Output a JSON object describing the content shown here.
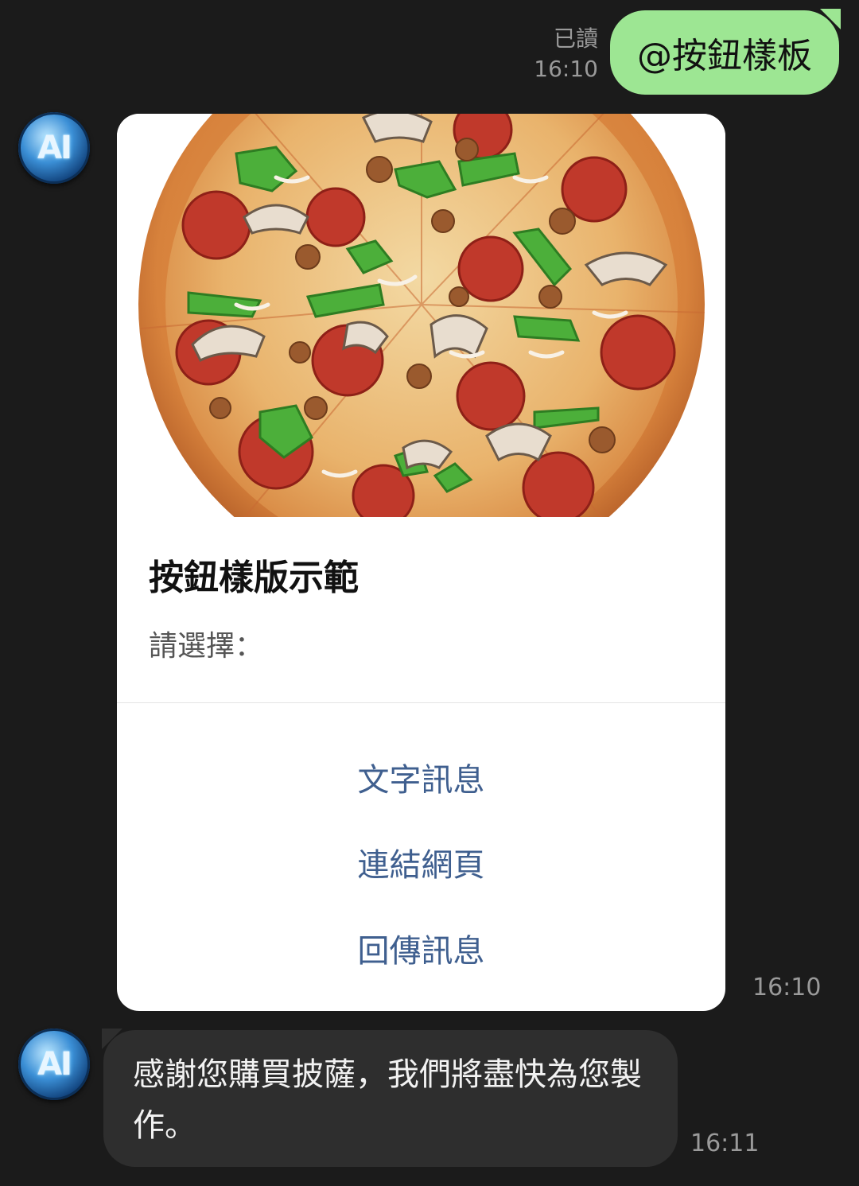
{
  "outgoing": {
    "text": "@按鈕樣板",
    "read": "已讀",
    "time": "16:10"
  },
  "avatar": {
    "label": "AI"
  },
  "card": {
    "title": "按鈕樣版示範",
    "text": "請選擇：",
    "actions": [
      "文字訊息",
      "連結網頁",
      "回傳訊息"
    ],
    "time": "16:10"
  },
  "incoming": {
    "text": "感謝您購買披薩，我們將盡快為您製作。",
    "time": "16:11"
  },
  "colors": {
    "background": "#1b1b1b",
    "outgoing_bubble": "#9de693",
    "incoming_bubble": "#2e2e2e",
    "action_text": "#3f5f8f"
  }
}
